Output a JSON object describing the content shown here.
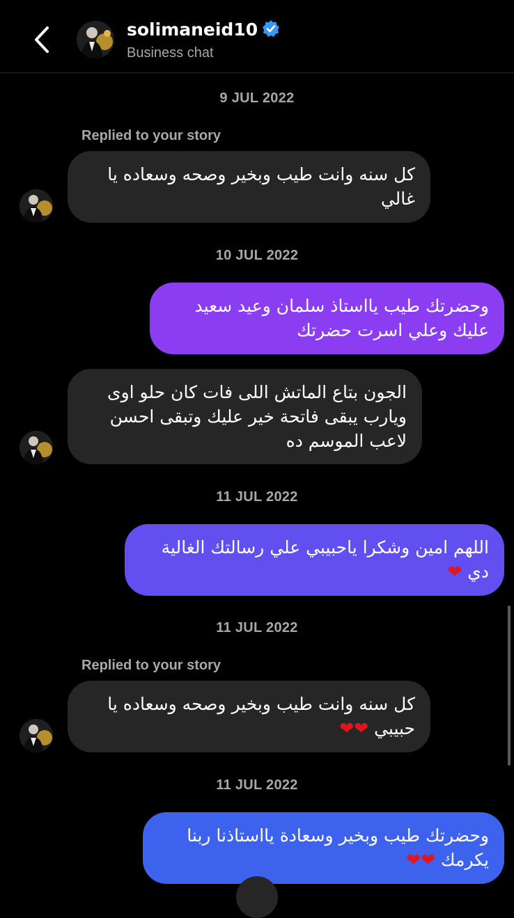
{
  "header": {
    "username": "solimaneid10",
    "subtitle": "Business chat"
  },
  "colors": {
    "incoming_bubble": "#262626",
    "verified_badge": "#3897f0",
    "heart": "#e0161f",
    "gradient_top": "#8e3cf2",
    "gradient_bottom": "#3d63ee"
  },
  "messages": {
    "date1": "9 JUL 2022",
    "reply1": "Replied to your story",
    "m1": "كل سنه وانت طيب وبخير وصحه وسعاده يا غالي",
    "date2": "10 JUL 2022",
    "m2": "وحضرتك طيب يااستاذ سلمان وعيد سعيد عليك وعلي اسرت حضرتك",
    "m3": "الجون بتاع الماتش اللى فات كان حلو اوى ويارب يبقى فاتحة خير عليك وتبقى احسن لاعب الموسم ده",
    "date3": "11 JUL 2022",
    "m4": "اللهم امين وشكرا ياحبيبي علي رسالتك الغالية دي",
    "m4_hearts": "❤",
    "date4": "11 JUL 2022",
    "reply2": "Replied to your story",
    "m5": "كل سنه وانت طيب وبخير وصحه وسعاده يا حبيبي",
    "m5_hearts": "❤❤",
    "date5": "11 JUL 2022",
    "m6": "وحضرتك طيب وبخير وسعادة يااستاذنا ربنا يكرمك",
    "m6_hearts": "❤❤"
  }
}
